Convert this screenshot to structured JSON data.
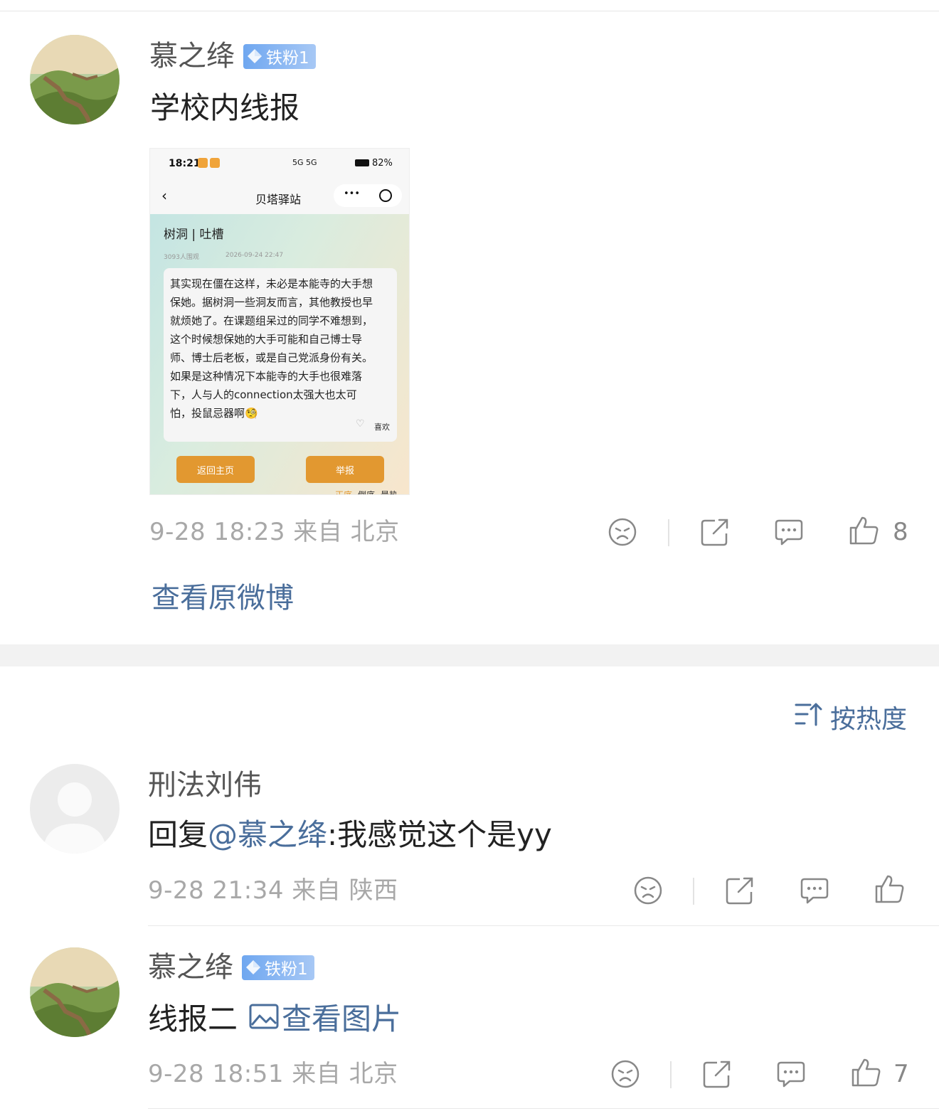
{
  "post": {
    "username": "慕之绛",
    "badge": "铁粉1",
    "text": "学校内线报",
    "meta": "9-28 18:23  来自 北京",
    "like_count": "8",
    "view_original": "查看原微博",
    "embedded": {
      "status_time": "18:21",
      "status_battery": "82%",
      "status_signal": "5G 5G",
      "nav_title": "贝塔驿站",
      "nav_more": "•••",
      "post_title": "树洞 | 吐槽",
      "views": "3093人围观",
      "date": "2026-09-24 22:47",
      "content": "其实现在僵在这样，未必是本能寺的大手想\n保她。据树洞一些洞友而言，其他教授也早\n就烦她了。在课题组呆过的同学不难想到，\n这个时候想保她的大手可能和自己博士导\n师、博士后老板，或是自己党派身份有关。\n如果是这种情况下本能寺的大手也很难落\n下，人与人的connection太强大也太可\n怕，投鼠忌器啊🧐",
      "like_label": "喜欢",
      "back_button": "返回主页",
      "report_button": "举报",
      "tabs": [
        "正序",
        "倒序",
        "最热"
      ]
    }
  },
  "sort": {
    "label": "按热度"
  },
  "comments": [
    {
      "username": "刑法刘伟",
      "reply_prefix": "回复",
      "mention": "@慕之绛",
      "text": ":我感觉这个是yy",
      "meta": "9-28 21:34  来自 陕西",
      "like_count": ""
    },
    {
      "username": "慕之绛",
      "badge": "铁粉1",
      "text": "线报二",
      "image_link": "查看图片",
      "meta": "9-28 18:51  来自 北京",
      "like_count": "7"
    }
  ],
  "colors": {
    "link": "#4a6e9b",
    "badge": "#6fa7f0",
    "button": "#e29830"
  }
}
